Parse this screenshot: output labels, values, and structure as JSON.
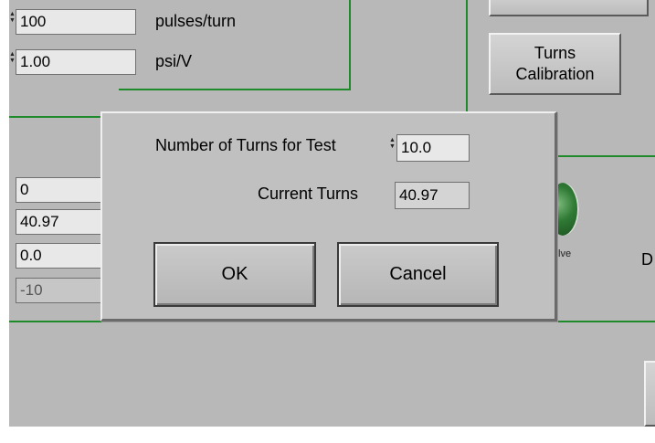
{
  "settings": {
    "pulses_value": "100",
    "pulses_unit": "pulses/turn",
    "psi_value": "1.00",
    "psi_unit": "psi/V"
  },
  "turns_calibration_button": {
    "line1": "Turns",
    "line2": "Calibration"
  },
  "readouts": [
    "0",
    "40.97",
    "0.0",
    "-10"
  ],
  "valve_label": "lve",
  "edge_letter": "D",
  "dialog": {
    "test_turns_label": "Number of Turns for Test",
    "test_turns_value": "10.0",
    "current_turns_label": "Current Turns",
    "current_turns_value": "40.97",
    "ok_label": "OK",
    "cancel_label": "Cancel"
  },
  "colors": {
    "panel": "#b8b8b8",
    "divider_green": "#1e8a2a",
    "field_bg": "#e8e8e8"
  }
}
